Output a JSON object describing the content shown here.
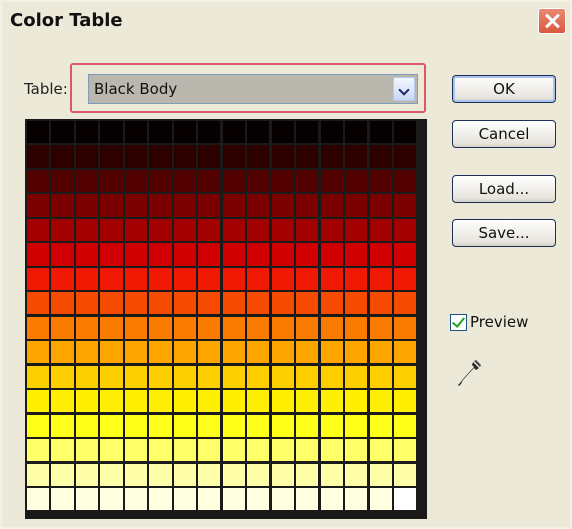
{
  "window": {
    "title": "Color Table",
    "close_icon": "close-icon"
  },
  "table": {
    "label": "Table:",
    "selected": "Black Body",
    "dropdown_icon": "chevron-down-icon"
  },
  "buttons": {
    "ok": "OK",
    "cancel": "Cancel",
    "load": "Load...",
    "save": "Save..."
  },
  "preview": {
    "label": "Preview",
    "checked": true
  },
  "tools": {
    "eyedropper_icon": "eyedropper-icon"
  },
  "colors": {
    "highlight_border": "#d95a66",
    "dialog_bg": "#ece9d8",
    "grid_line": "#ffffff"
  },
  "color_table": {
    "name": "Black Body",
    "columns": 16,
    "rows": 16,
    "row_colors": [
      "#060000",
      "#2d0000",
      "#520000",
      "#7a0000",
      "#a30000",
      "#d00000",
      "#ef1800",
      "#f54a00",
      "#fb7a00",
      "#fda600",
      "#fecf00",
      "#ffef00",
      "#ffff1a",
      "#ffff6a",
      "#ffffaa",
      "#ffffe0"
    ],
    "last_cell": "#ffffff"
  }
}
